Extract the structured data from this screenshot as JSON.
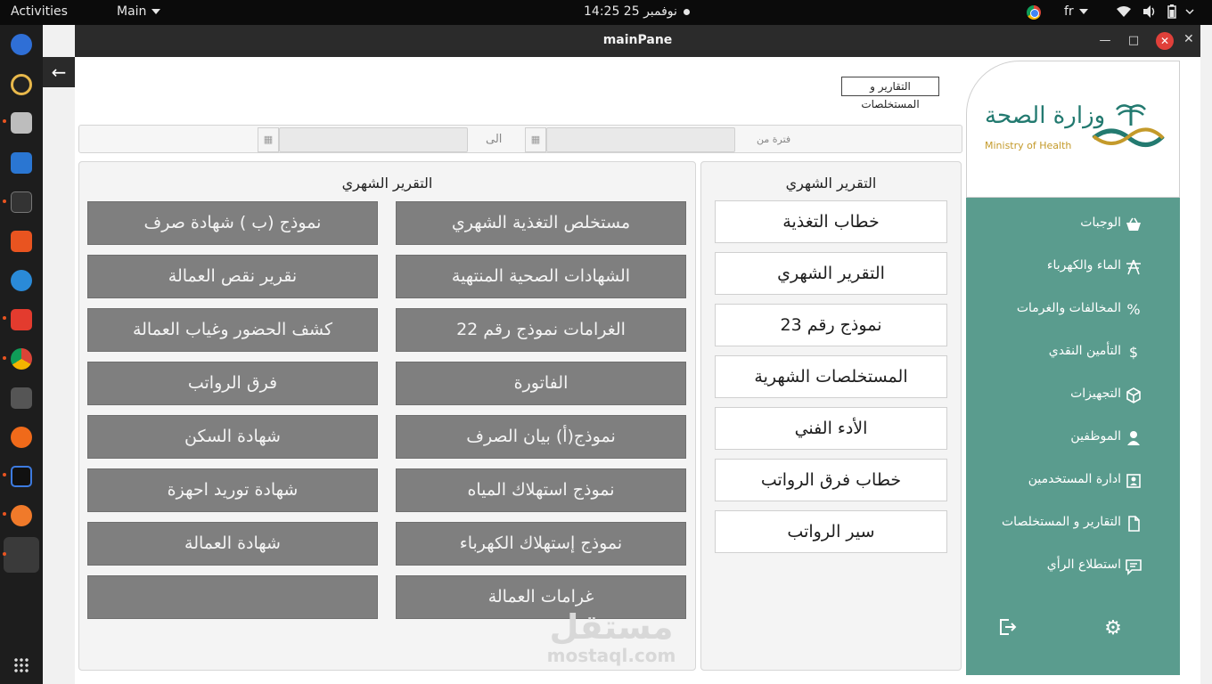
{
  "topbar": {
    "activities": "Activities",
    "app_menu": "Main",
    "clock": "14:25  نوفمبر 25",
    "language": "fr"
  },
  "window": {
    "title": "mainPane"
  },
  "header": {
    "section_label": "التقارير و المستخلصات"
  },
  "filter": {
    "from_label": "فترة من",
    "to_label": "الى",
    "from_value": "",
    "to_value": ""
  },
  "left_panel": {
    "title": "التقرير الشهري",
    "buttons": [
      "مستخلص التغذية الشهري",
      "نموذج (ب ) شهادة صرف",
      "الشهادات الصحية المنتهية",
      "نقرير نقص العمالة",
      "الغرامات نموذج رقم 22",
      "كشف الحضور وغياب العمالة",
      "الفاتورة",
      "فرق الرواتب",
      "نموذج(أ) بيان الصرف",
      "شهادة السكن",
      "نموذج استهلاك المياه",
      "شهادة توريد احهزة",
      "نموذج إستهلاك الكهرباء",
      "شهادة العمالة",
      "غرامات العمالة",
      ""
    ]
  },
  "right_panel": {
    "title": "التقرير الشهري",
    "buttons": [
      "خطاب التغذية",
      "التقرير الشهري",
      "نموذج رقم 23",
      "المستخلصات الشهرية",
      "الأدء الفني",
      "خطاب فرق الرواتب",
      "سير الرواتب"
    ]
  },
  "logo": {
    "arabic": "وزارة الصحة",
    "english": "Ministry of Health"
  },
  "sidebar": {
    "items": [
      {
        "label": "الوجبات",
        "icon": "basket-icon"
      },
      {
        "label": "الماء والكهرباء",
        "icon": "tower-icon"
      },
      {
        "label": "المخالفات والغرمات",
        "icon": "percent-icon"
      },
      {
        "label": "التأمين النقدي",
        "icon": "dollar-icon"
      },
      {
        "label": "التجهيزات",
        "icon": "box-icon"
      },
      {
        "label": "الموظفين",
        "icon": "person-icon"
      },
      {
        "label": "ادارة المستخدمين",
        "icon": "user-card-icon"
      },
      {
        "label": "التقارير و المستخلصات",
        "icon": "file-icon"
      },
      {
        "label": "استطلاع الرأي",
        "icon": "comment-icon"
      }
    ],
    "logout_icon": "logout-icon",
    "settings_icon": "gear-icon"
  },
  "watermark": {
    "arabic": "مستقل",
    "latin": "mostaql.com"
  },
  "colors": {
    "sidebar": "#5a9c8e",
    "report_button": "#7f7f7f",
    "logo_green": "#237a70",
    "logo_gold": "#c49a2a"
  }
}
